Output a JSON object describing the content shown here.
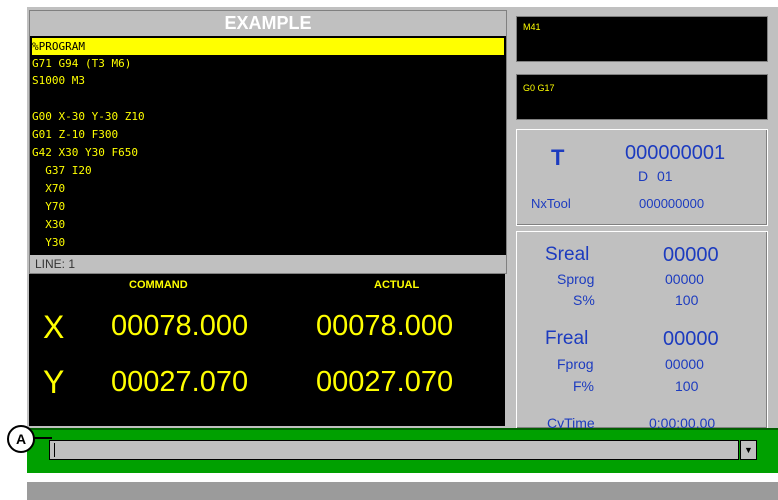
{
  "program": {
    "title": "EXAMPLE",
    "lines": [
      "%PROGRAM",
      "G71 G94 (T3 M6)",
      "S1000 M3",
      "",
      "G00 X-30 Y-30 Z10",
      "G01 Z-10 F300",
      "G42 X30 Y30 F650",
      "  G37 I20",
      "  X70",
      "  Y70",
      "  X30",
      "  Y30"
    ],
    "line_indicator": "LINE: 1"
  },
  "coords": {
    "command_header": "COMMAND",
    "actual_header": "ACTUAL",
    "rows": [
      {
        "axis": "X",
        "command": "00078.000",
        "actual": "00078.000"
      },
      {
        "axis": "Y",
        "command": "00027.070",
        "actual": "00027.070"
      }
    ]
  },
  "status_boxes": {
    "m_codes": "M41",
    "g_codes": "G0 G17"
  },
  "tool": {
    "label": "T",
    "number": "000000001",
    "d_label": "D",
    "d_value": "01",
    "next_label": "NxTool",
    "next_value": "000000000"
  },
  "spindle": {
    "sreal_label": "Sreal",
    "sreal_value": "00000",
    "sprog_label": "Sprog",
    "sprog_value": "00000",
    "spct_label": "S%",
    "spct_value": "100",
    "freal_label": "Freal",
    "freal_value": "00000",
    "fprog_label": "Fprog",
    "fprog_value": "00000",
    "fpct_label": "F%",
    "fpct_value": "100",
    "cytime_label": "CyTime",
    "cytime_value": "0:00:00.00"
  },
  "command_line": {
    "value": "",
    "dropdown_icon": "chevron-down-icon"
  },
  "annotation": {
    "marker": "A"
  },
  "colors": {
    "code_text": "#ffff00",
    "highlight": "#ffff00",
    "info_blue": "#1c3bbf",
    "command_bar": "#00a000"
  }
}
